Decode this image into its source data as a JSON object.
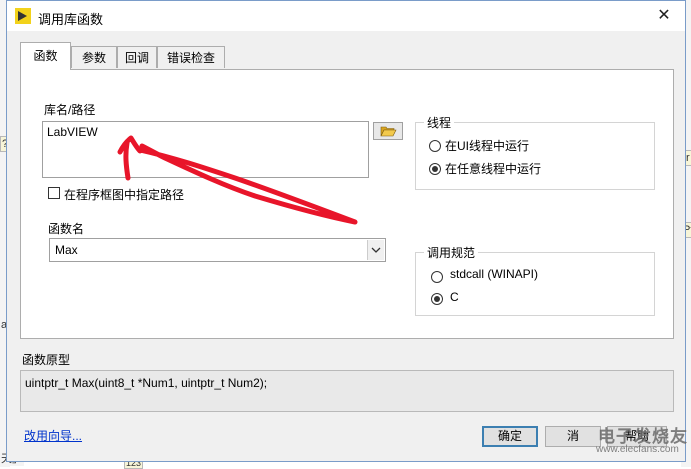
{
  "window": {
    "title": "调用库函数",
    "close_glyph": "✕"
  },
  "tabs": [
    {
      "label": "函数",
      "active": true
    },
    {
      "label": "参数",
      "active": false
    },
    {
      "label": "回调",
      "active": false
    },
    {
      "label": "错误检查",
      "active": false
    }
  ],
  "library": {
    "label": "库名/路径",
    "value": "LabVIEW",
    "specify_path_label": "在程序框图中指定路径",
    "specify_path_checked": false
  },
  "function": {
    "label": "函数名",
    "value": "Max"
  },
  "thread": {
    "title": "线程",
    "options": [
      "在UI线程中运行",
      "在任意线程中运行"
    ],
    "selected": 1
  },
  "calling_convention": {
    "title": "调用规范",
    "options": [
      "stdcall (WINAPI)",
      "C"
    ],
    "selected": 1
  },
  "prototype": {
    "label": "函数原型",
    "value": "uintptr_t Max(uint8_t *Num1, uintptr_t Num2);"
  },
  "footer": {
    "wizard_link": "改用向导...",
    "ok_label": "确定",
    "cancel_label": "消",
    "help_label": "帮助"
  },
  "watermark": {
    "line1": "电子发烧友",
    "line2": "www.elecfans.com"
  },
  "background_fragments": [
    "?",
    "Ir",
    "Pt",
    "ay",
    "天」",
    "123"
  ],
  "annotation": {
    "color": "#e8152a"
  }
}
